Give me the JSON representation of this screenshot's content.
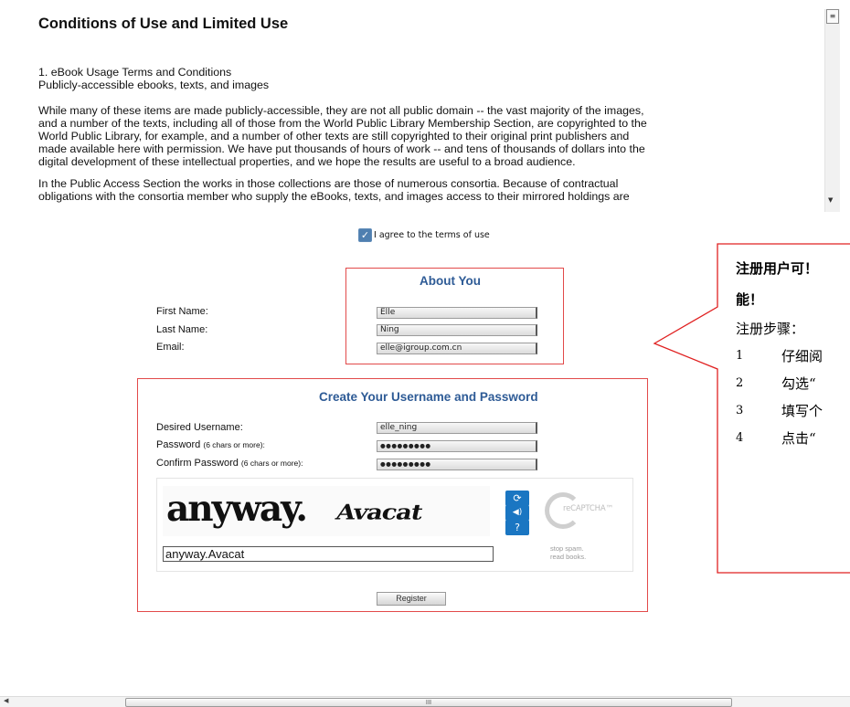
{
  "terms": {
    "title": "Conditions of Use and Limited Use",
    "heading1": "1. eBook Usage Terms and Conditions",
    "heading2": "Publicly-accessible ebooks, texts, and images",
    "para1_lines": [
      "While many of these items are made publicly-accessible, they are not all public domain -- the vast majority of the images,",
      "and a number of the texts, including all of those from the World Public Library Membership Section, are copyrighted to the",
      "World Public Library, for example, and a number of other texts are still copyrighted to their original print publishers and",
      "made available here with permission. We have put thousands of hours of work -- and tens of thousands of dollars into the",
      "digital development of these intellectual properties, and we hope the results are useful to a broad audience."
    ],
    "para2_lines": [
      "In the Public Access Section the works in those collections are those of numerous consortia. Because of contractual",
      "obligations with the consortia member who supply the eBooks, texts, and images access to their mirrored holdings are"
    ]
  },
  "agree": {
    "label": "I agree to the terms of use",
    "checked": true
  },
  "about_you": {
    "title": "About You",
    "first_name_label": "First Name:",
    "last_name_label": "Last Name:",
    "email_label": "Email:",
    "first_name": "Elle",
    "last_name": "Ning",
    "email": "elle@igroup.com.cn"
  },
  "account": {
    "title": "Create Your Username and Password",
    "username_label": "Desired Username:",
    "password_label": "Password",
    "password_hint": "(6 chars or more):",
    "confirm_label": "Confirm Password",
    "confirm_hint": "(6 chars or more):",
    "username": "elle_ning",
    "password_mask": "●●●●●●●●●",
    "confirm_mask": "●●●●●●●●●"
  },
  "captcha": {
    "word1": "anyway.",
    "word2": "Avacat",
    "input_value": "anyway.Avacat",
    "logo_text": "reCAPTCHA™",
    "tagline_1": "stop spam.",
    "tagline_2": "read books.",
    "icons": [
      "refresh-icon",
      "audio-icon",
      "help-icon"
    ]
  },
  "register_label": "Register",
  "callout": {
    "heading_line1": "注册用户可！",
    "heading_line2": "能！",
    "steps_title": "注册步骤：",
    "steps": [
      {
        "num": "1",
        "text": "仔细阅"
      },
      {
        "num": "2",
        "text": "勾选“"
      },
      {
        "num": "3",
        "text": "填写个"
      },
      {
        "num": "4",
        "text": "点击“"
      }
    ]
  },
  "scrollbar": {
    "grip_glyph": "III"
  },
  "colors": {
    "red_border": "#e24a4a",
    "section_title": "#2e5b96",
    "captcha_button": "#1a76c2"
  }
}
